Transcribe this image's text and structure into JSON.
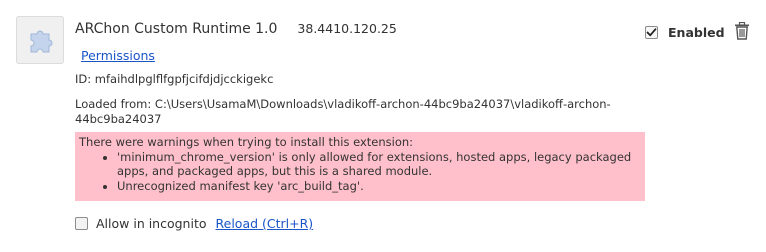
{
  "extension": {
    "icon": "puzzle-piece-icon",
    "name": "ARChon Custom Runtime 1.0",
    "version": "38.4410.120.25",
    "permissions_link": "Permissions",
    "id_line": "ID: mfaihdlpglflfgpfjcifdjdjcckigekc",
    "loaded_from_label": "Loaded from: ",
    "loaded_from_path": "C:\\Users\\UsamaM\\Downloads\\vladikoff-archon-44bc9ba24037\\vladikoff-archon-44bc9ba24037",
    "enabled": {
      "checked": true,
      "label": "Enabled"
    },
    "trash_icon": "trash-icon"
  },
  "warnings": {
    "heading": "There were warnings when trying to install this extension:",
    "items": [
      "'minimum_chrome_version' is only allowed for extensions, hosted apps, legacy packaged apps, and packaged apps, but this is a shared module.",
      "Unrecognized manifest key 'arc_build_tag'."
    ],
    "background_color": "#ffc0cb"
  },
  "footer": {
    "incognito_checked": false,
    "incognito_label": "Allow in incognito",
    "reload_link": "Reload (Ctrl+R)"
  },
  "colors": {
    "link": "#1a55c8",
    "text": "#333333"
  }
}
